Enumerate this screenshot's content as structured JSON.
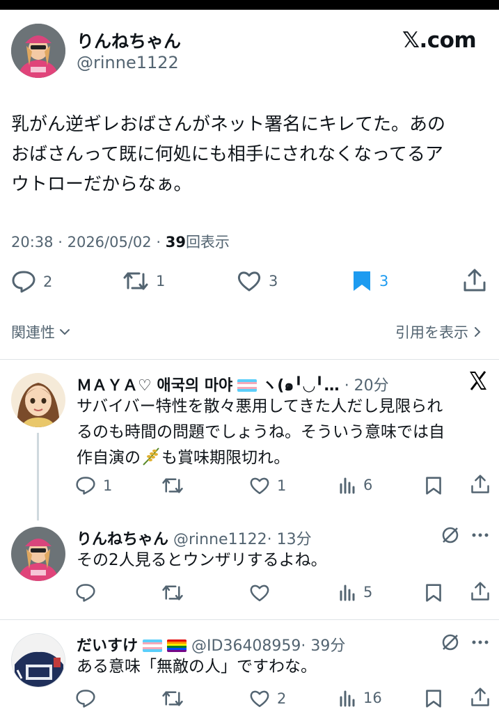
{
  "main_post": {
    "display_name": "りんねちゃん",
    "handle": "@rinne1122",
    "brand": "𝕏.com",
    "text_lines": [
      "乳がん逆ギレおばさんがネット署名にキレてた。あの",
      "おばさんって既に何処にも相手にされなくなってるア",
      "ウトローだからなぁ。"
    ],
    "time": "20:38",
    "date": "2026/05/02",
    "sep": "·",
    "views": "39",
    "views_label": "回表示",
    "stats": {
      "replies": "2",
      "reposts": "1",
      "likes": "3",
      "bookmarks": "3"
    }
  },
  "related": {
    "left": "関連性",
    "right": "引用を表示"
  },
  "replies": [
    {
      "display_name": "ＭＡＹＡ♡ 애국의 마야",
      "name_tail": "ヽ(๑╹◡╹…",
      "time": "· 20分",
      "text_lines": [
        "サバイバー特性を散々悪用してきた人だし見限られ",
        "るのも時間の問題でしょうね。そういう意味では自",
        "作自演の",
        "も賞味期限切れ。"
      ],
      "stats": {
        "replies": "1",
        "reposts": "",
        "likes": "1",
        "views": "6"
      }
    },
    {
      "display_name": "りんねちゃん",
      "handle": "@rinne1122",
      "time": "· 13分",
      "text_lines": [
        "その2人見るとウンザリするよね。"
      ],
      "stats": {
        "replies": "",
        "reposts": "",
        "likes": "",
        "views": "5"
      }
    },
    {
      "display_name": "だいすけ",
      "handle": "@ID36408959",
      "time": "· 39分",
      "text_lines": [
        "ある意味「無敵の人」ですわな。"
      ],
      "stats": {
        "replies": "",
        "reposts": "",
        "likes": "2",
        "views": "16"
      }
    }
  ],
  "colors": {
    "accent": "#1d9bf0",
    "text": "#0f1419",
    "muted": "#536471"
  }
}
